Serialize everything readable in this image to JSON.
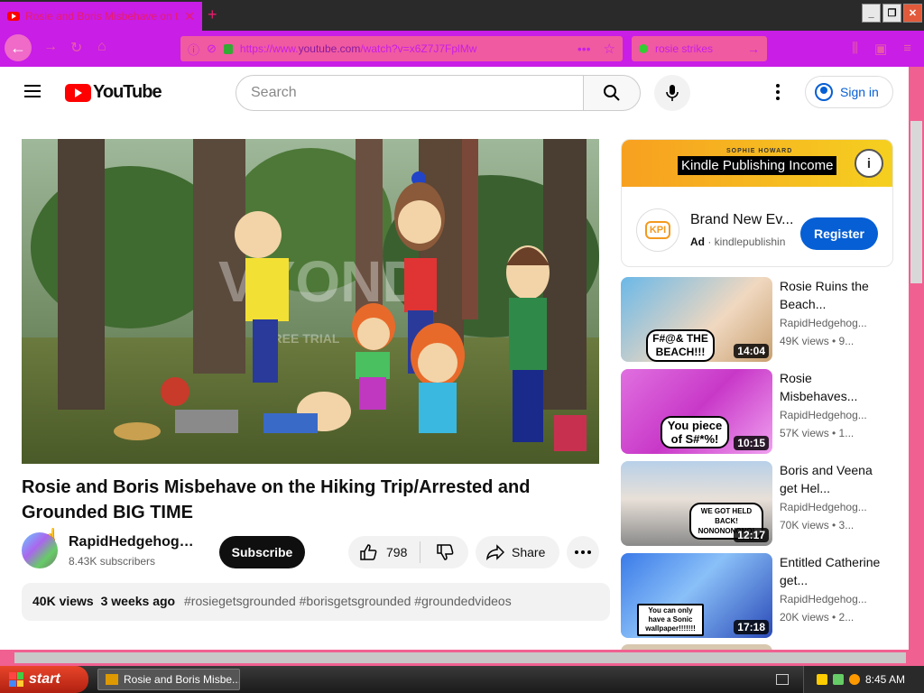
{
  "browser": {
    "tab_title": "Rosie and Boris Misbehave on the Hiking Trip/Arrested",
    "url_prefix": "https://www.",
    "url_domain": "youtube.com",
    "url_path": "/watch?v=x6Z7J7FplMw",
    "search_query": "rosie strikes",
    "accent_color": "#c81ee6"
  },
  "masthead": {
    "logo_text": "YouTube",
    "search_placeholder": "Search",
    "signin_label": "Sign in"
  },
  "video": {
    "title": "Rosie and Boris Misbehave on the Hiking Trip/Arrested and Grounded BIG TIME",
    "watermark": "VYOND",
    "watermark_sub": "FREE TRIAL",
    "channel_name": "RapidHedgehogA...",
    "subscribers": "8.43K subscribers",
    "subscribe_label": "Subscribe",
    "likes": "798",
    "share_label": "Share",
    "views": "40K views",
    "date": "3 weeks ago",
    "hashtags": "#rosiegetsgrounded #borisgetsgrounded #groundedvideos"
  },
  "ad": {
    "banner_sub": "SOPHIE HOWARD",
    "banner_headline": "Kindle Publishing Income",
    "title": "Brand New Ev...",
    "ad_label": "Ad",
    "advertiser": "kindlepublishin",
    "register_label": "Register",
    "logo_text": "KPI"
  },
  "related": [
    {
      "title": "Rosie Ruins the Beach...",
      "channel": "RapidHedgehog...",
      "views": "49K views • 9...",
      "duration": "14:04",
      "caption": "F#@& THE BEACH!!!"
    },
    {
      "title": "Rosie Misbehaves...",
      "channel": "RapidHedgehog...",
      "views": "57K views • 1...",
      "duration": "10:15",
      "caption": "You piece of S#*%!"
    },
    {
      "title": "Boris and Veena get Hel...",
      "channel": "RapidHedgehog...",
      "views": "70K views • 3...",
      "duration": "12:17",
      "caption": "WE GOT HELD BACK! NONONONONO!"
    },
    {
      "title": "Entitled Catherine get...",
      "channel": "RapidHedgehog...",
      "views": "20K views • 2...",
      "duration": "17:18",
      "caption": "You can only have a Sonic wallpaper!!!!!!!"
    }
  ],
  "taskbar": {
    "start_label": "start",
    "task_label": "Rosie and Boris Misbe...",
    "clock": "8:45 AM"
  }
}
